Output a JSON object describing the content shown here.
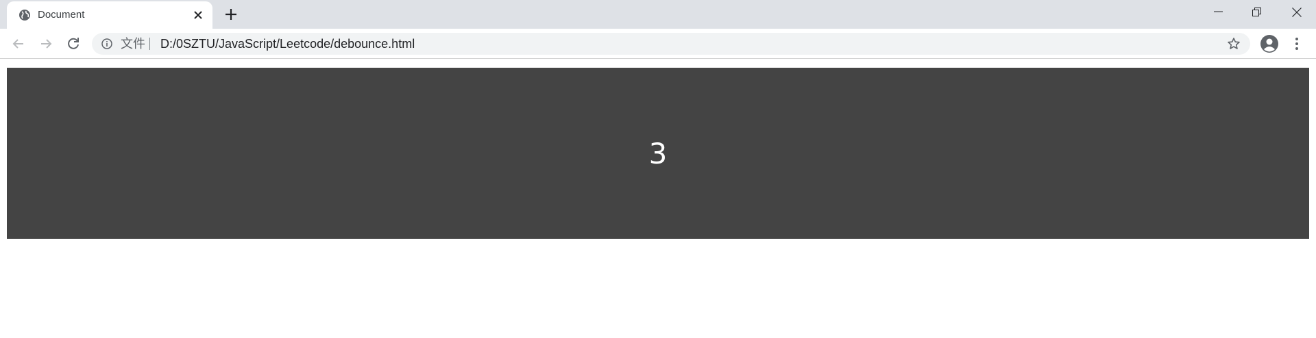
{
  "browser": {
    "tab": {
      "title": "Document",
      "favicon": "globe-icon"
    },
    "address_bar": {
      "scheme_label": "文件",
      "url": "D:/0SZTU/JavaScript/Leetcode/debounce.html"
    }
  },
  "page": {
    "box_value": "3"
  },
  "colors": {
    "tabstrip": "#dee1e6",
    "omnibox": "#f1f3f4",
    "box_background": "#444444",
    "box_text": "#ffffff"
  }
}
